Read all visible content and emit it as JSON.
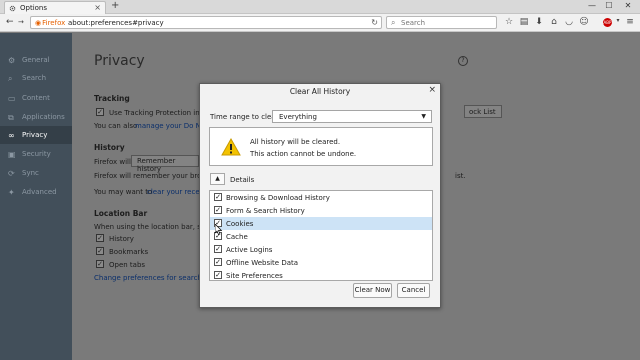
{
  "window": {
    "tab_title": "Options",
    "new_tab_label": "+",
    "tab_close": "×",
    "controls": {
      "minimize": "—",
      "maximize": "☐",
      "close": "✕"
    }
  },
  "nav": {
    "identity_label": "Firefox",
    "url": "about:preferences#privacy",
    "search_placeholder": "Search"
  },
  "sidebar": {
    "items": [
      {
        "label": "General",
        "icon": "gear-icon"
      },
      {
        "label": "Search",
        "icon": "search-icon"
      },
      {
        "label": "Content",
        "icon": "document-icon"
      },
      {
        "label": "Applications",
        "icon": "applications-icon"
      },
      {
        "label": "Privacy",
        "icon": "mask-icon",
        "active": true
      },
      {
        "label": "Security",
        "icon": "lock-icon"
      },
      {
        "label": "Sync",
        "icon": "sync-icon"
      },
      {
        "label": "Advanced",
        "icon": "wizard-icon"
      }
    ]
  },
  "content": {
    "title": "Privacy",
    "tracking_heading": "Tracking",
    "tracking_checkbox": "Use Tracking Protection in Pr",
    "tracking_text": "You can also",
    "tracking_link": "manage your Do Not",
    "exceptions_button": "ock List",
    "history_heading": "History",
    "history_will": "Firefox will:",
    "history_mode": "Remember history",
    "history_text": "Firefox will remember your brows",
    "history_text_suffix": "ist.",
    "clear_text": "You may want to",
    "clear_link": "clear your recent",
    "location_heading": "Location Bar",
    "location_text": "When using the location bar, sugg",
    "location_options": [
      "History",
      "Bookmarks",
      "Open tabs"
    ],
    "location_link": "Change preferences for search eng"
  },
  "dialog": {
    "title": "Clear All History",
    "time_range_label": "Time range to clear:",
    "time_range_value": "Everything",
    "warning_line1": "All history will be cleared.",
    "warning_line2": "This action cannot be undone.",
    "details_label": "Details",
    "items": [
      {
        "label": "Browsing & Download History",
        "checked": true
      },
      {
        "label": "Form & Search History",
        "checked": true
      },
      {
        "label": "Cookies",
        "checked": true,
        "selected": true
      },
      {
        "label": "Cache",
        "checked": true
      },
      {
        "label": "Active Logins",
        "checked": true
      },
      {
        "label": "Offline Website Data",
        "checked": true
      },
      {
        "label": "Site Preferences",
        "checked": true
      }
    ],
    "clear_now": "Clear Now",
    "cancel": "Cancel"
  },
  "colors": {
    "sidebar_bg": "#424f5a",
    "sidebar_active": "#343f48",
    "selection": "#cde3f6",
    "firefox_orange": "#e66000"
  }
}
